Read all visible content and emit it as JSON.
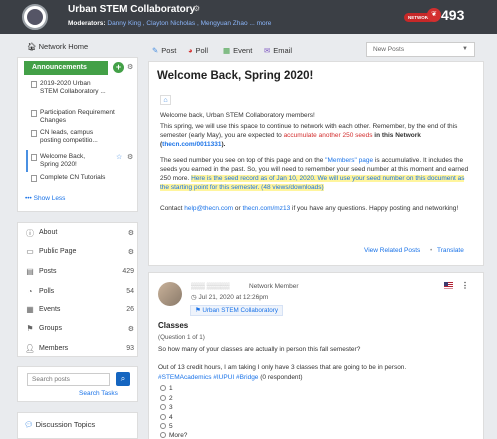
{
  "header": {
    "title": "Urban STEM Collaboratory",
    "moderators_label": "Moderators:",
    "moderators": "Danny King , Clayton Nicholas , Mengyuan Zhao ... more",
    "network_pill": "NETWORK",
    "network_count": "493",
    "colors": {
      "bg": "#3b3f45",
      "accent": "#d32f2f"
    }
  },
  "sidebar": {
    "network_home": "Network Home",
    "announcements_label": "Announcements",
    "announcements": [
      "2019-2020 Urban STEM Collaboratory ...",
      "Participation Requirement Changes",
      "CN leads, campus posting competitio...",
      "Welcome Back, Spring 2020!",
      "Complete CN Tutorials"
    ],
    "show_less": "Show Less",
    "menu": [
      {
        "icon": "info-icon",
        "label": "About",
        "count": ""
      },
      {
        "icon": "page-icon",
        "label": "Public Page",
        "count": ""
      },
      {
        "icon": "posts-icon",
        "label": "Posts",
        "count": "429"
      },
      {
        "icon": "polls-icon",
        "label": "Polls",
        "count": "54"
      },
      {
        "icon": "events-icon",
        "label": "Events",
        "count": "26"
      },
      {
        "icon": "groups-icon",
        "label": "Groups",
        "count": ""
      },
      {
        "icon": "members-icon",
        "label": "Members",
        "count": "93"
      }
    ],
    "search_placeholder": "Search posts",
    "search_tasks": "Search Tasks",
    "discussion_topics": "Discussion Topics"
  },
  "toolbar": {
    "post": "Post",
    "poll": "Poll",
    "event": "Event",
    "email": "Email",
    "sort_value": "New Posts"
  },
  "welcome_post": {
    "title": "Welcome Back, Spring 2020!",
    "p1": "Welcome back, Urban STEM Collaboratory members!",
    "p2a": "This spring, we will use this space to continue to network with each other. Remember, by the end of this semester (early May), you are expected to ",
    "p2_red": "accumulate another 250 seeds",
    "p2b": " in this Network (",
    "p2_link": "thecn.com/0011331",
    "p2c": ").",
    "p3a": "The seed number you see on top of this page and on the ",
    "p3_link": "\"Members\" page",
    "p3b": " is accumulative. It includes the seeds you earned in the past. So, you will need to remember your seed number at this moment and earned 250 more. ",
    "p3_hl": "Here is the seed record as of Jan 10, 2020. We will use your seed number on this document as the starting point for this semester. (48 views/downloads)",
    "p4a": "Contact ",
    "p4_link1": "help@thecn.com",
    "p4b": " or ",
    "p4_link2": "thecn.com/mz13",
    "p4c": " if you have any questions. Happy posting and networking!",
    "view_related": "View Related Posts",
    "dot": "•",
    "translate": "Translate"
  },
  "poll_post": {
    "author_role": "Network Member",
    "date": "Jul 21, 2020 at 12:26pm",
    "group": "Urban STEM Collaboratory",
    "title": "Classes",
    "question_count": "(Question 1 of 1)",
    "question": "So how many of your classes are actually in person this fall semester?",
    "body": "Out of 13 credit hours, I am taking I only have 3 classes that are going to be in person.",
    "hashtags": "#STEMAcademics #IUPUI #Bridge",
    "respondents": " (0 respondent)",
    "options": [
      "1",
      "2",
      "3",
      "4",
      "5",
      "More?"
    ]
  }
}
